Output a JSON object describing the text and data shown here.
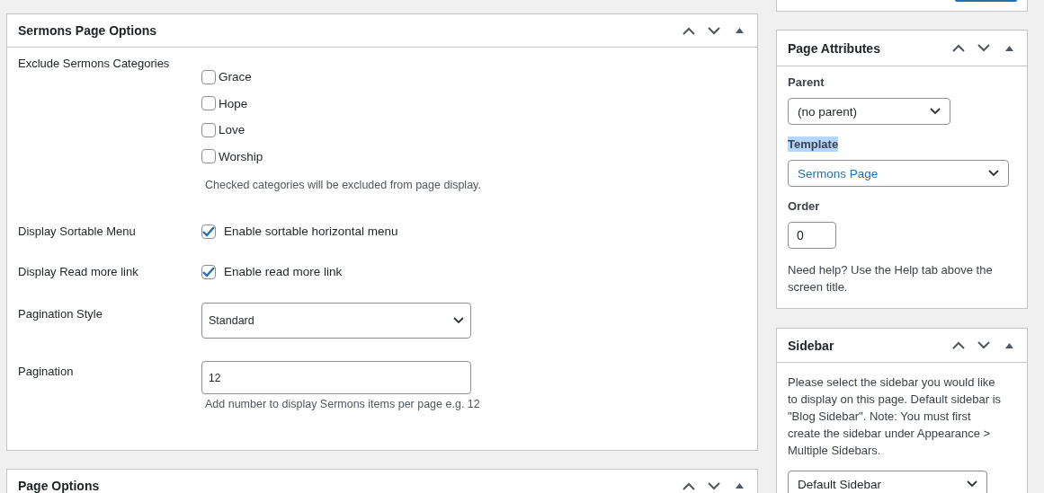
{
  "main_panels": [
    {
      "title": "Sermons Page Options",
      "fields": [
        {
          "kind": "checklist",
          "label": "Exclude Sermons Categories",
          "options": [
            {
              "label": "Grace",
              "checked": false
            },
            {
              "label": "Hope",
              "checked": false
            },
            {
              "label": "Love",
              "checked": false
            },
            {
              "label": "Worship",
              "checked": false
            }
          ],
          "help": "Checked categories will be excluded from page display."
        },
        {
          "kind": "checkbox",
          "label": "Display Sortable Menu",
          "option": "Enable sortable horizontal menu",
          "checked": true
        },
        {
          "kind": "checkbox",
          "label": "Display Read more link",
          "option": "Enable read more link",
          "checked": true
        },
        {
          "kind": "select",
          "label": "Pagination Style",
          "value": "Standard"
        },
        {
          "kind": "text",
          "label": "Pagination",
          "value": "12",
          "help": "Add number to display Sermons items per page e.g. 12"
        }
      ]
    },
    {
      "title": "Page Options"
    }
  ],
  "side_top": {
    "buttons": [
      {
        "kind": "primary"
      }
    ]
  },
  "page_attributes": {
    "title": "Page Attributes",
    "fields": [
      {
        "kind": "select",
        "label": "Parent",
        "value": "(no parent)",
        "highlighted": false,
        "link": false
      },
      {
        "kind": "select",
        "label": "Template",
        "value": "Sermons Page",
        "highlighted": true,
        "link": true
      },
      {
        "kind": "text",
        "label": "Order",
        "value": "0",
        "highlighted": false
      }
    ],
    "help": "Need help? Use the Help tab above the screen title."
  },
  "sidebar_box": {
    "title": "Sidebar",
    "description": "Please select the sidebar you would like to display on this page. Default sidebar is \"Blog Sidebar\". Note: You must first create the sidebar under Appearance > Multiple Sidebars.",
    "select": "Default Sidebar"
  }
}
